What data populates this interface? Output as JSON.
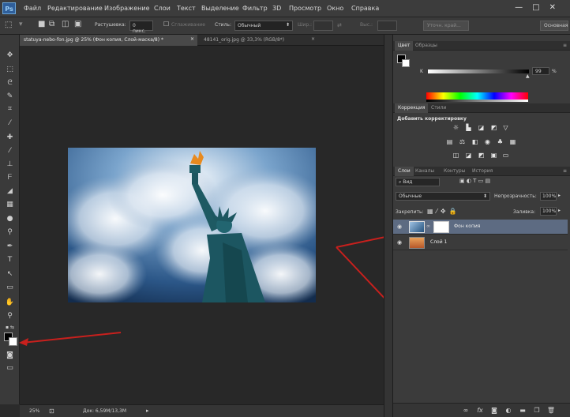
{
  "app": {
    "logo": "Ps",
    "window_controls": "—□✕",
    "menu": [
      "Файл",
      "Редактирование",
      "Изображение",
      "Слои",
      "Текст",
      "Выделение",
      "Фильтр",
      "3D",
      "Просмотр",
      "Окно",
      "Справка"
    ]
  },
  "options": {
    "feather_label": "Растушевка:",
    "feather_value": "0 пикс.",
    "antialias_label": "Сглаживание",
    "style_label": "Стиль:",
    "style_value": "Обычный",
    "width_label": "Шир.:",
    "height_label": "Выс.:",
    "refine_edge": "Уточн. край...",
    "workspace": "Основная"
  },
  "documents": [
    {
      "title": "statuya-nebo-fon.jpg @ 25% (Фон копия, Слой-маска/8) *",
      "close": "×",
      "active": true
    },
    {
      "title": "48141_orig.jpg @ 33,3% (RGB/8*)",
      "close": "×",
      "active": false
    }
  ],
  "status": {
    "zoom": "25%",
    "doc": "Док: 6,59M/13,3M"
  },
  "color_panel": {
    "tabs": [
      "Цвет",
      "Образцы"
    ],
    "channel": "K",
    "value": "99",
    "unit": "%"
  },
  "adjustments_panel": {
    "tabs": [
      "Коррекция",
      "Стили"
    ],
    "heading": "Добавить корректировку"
  },
  "layers_panel": {
    "tabs": [
      "Слои",
      "Каналы",
      "Контуры",
      "История"
    ],
    "filter": "Вид",
    "blend_mode": "Обычные",
    "opacity_label": "Непрозрачность:",
    "opacity_value": "100%",
    "lock_label": "Закрепить:",
    "fill_label": "Заливка:",
    "fill_value": "100%",
    "layers": [
      {
        "name": "Фон копия",
        "selected": true
      },
      {
        "name": "Слой 1",
        "selected": false
      }
    ]
  },
  "colors": {
    "accent_arrow": "#c8201d",
    "selected_layer": "#5d6b82"
  }
}
